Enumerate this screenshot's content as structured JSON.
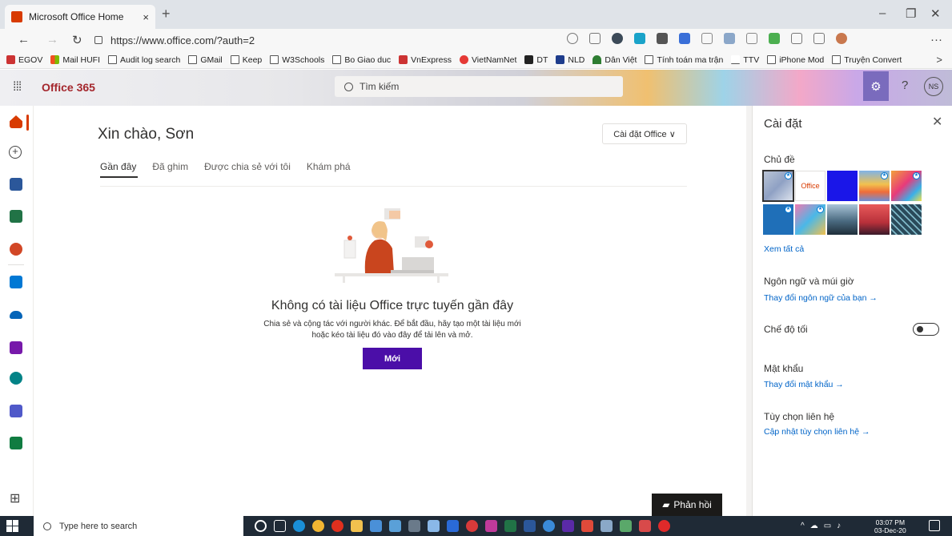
{
  "browser": {
    "tab_title": "Microsoft Office Home",
    "tab_close": "×",
    "new_tab": "+",
    "url": "https://www.office.com/?auth=2",
    "minimize": "–",
    "maximize": "❐",
    "close": "✕",
    "back": "←",
    "forward": "→",
    "refresh": "↻",
    "menu": "···",
    "bookmarks": [
      "EGOV",
      "Mail HUFI",
      "Audit log search",
      "GMail",
      "Keep",
      "W3Schools",
      "Bo Giao duc",
      "VnExpress",
      "VietNamNet",
      "DT",
      "NLD",
      "Dân Việt",
      "Tính toán ma trận",
      "TTV",
      "iPhone Mod",
      "Truyện Convert"
    ],
    "bookmarks_more": ">"
  },
  "header": {
    "app_name": "Office 365",
    "search_placeholder": "Tìm kiếm",
    "help": "?",
    "avatar_initials": "NS"
  },
  "main": {
    "greeting": "Xin chào, Sơn",
    "install_button": "Cài đặt Office ∨",
    "tabs": [
      "Gần đây",
      "Đã ghim",
      "Được chia sẻ với tôi",
      "Khám phá"
    ],
    "empty_title": "Không có tài liệu Office trực tuyến gần đây",
    "empty_line1": "Chia sẻ và cộng tác với người khác. Để bắt đầu, hãy tạo một tài liệu mới",
    "empty_line2": "hoặc kéo tài liệu đó vào đây để tải lên và mở.",
    "new_button": "Mới"
  },
  "settings": {
    "title": "Cài đặt",
    "close": "✕",
    "theme_heading": "Chủ đề",
    "theme_office_label": "Office",
    "see_all": "Xem tất cả",
    "language_heading": "Ngôn ngữ và múi giờ",
    "language_link": "Thay đổi ngôn ngữ của bạn →",
    "dark_mode": "Chế độ tối",
    "dark_mode_on": false,
    "password_heading": "Mật khẩu",
    "password_link": "Thay đổi mật khẩu →",
    "contact_heading": "Tùy chọn liên hệ",
    "contact_link": "Cập nhật tùy chọn liên hệ →"
  },
  "feedback": "Phản hồi",
  "taskbar": {
    "search_placeholder": "Type here to search",
    "time": "03:07 PM",
    "date": "03-Dec-20"
  },
  "colors": {
    "office_red": "#d83b01",
    "accent_purple": "#4b0ea8",
    "link_blue": "#0064c8"
  }
}
